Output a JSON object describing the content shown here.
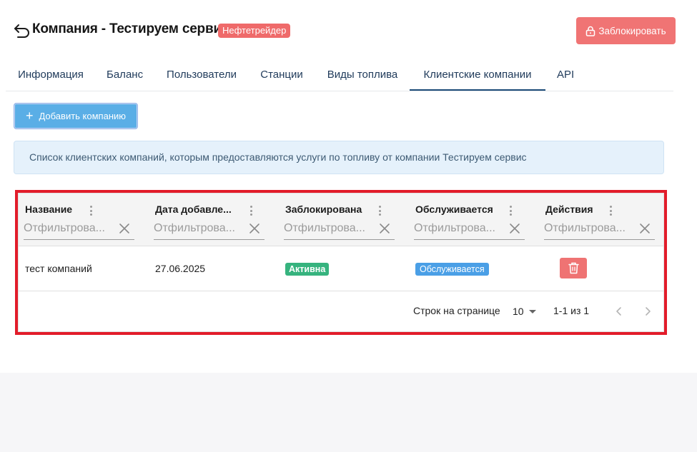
{
  "header": {
    "title": "Компания - Тестируем сервис",
    "role_badge": "Нефтетрейдер",
    "block_button": "Заблокировать"
  },
  "tabs": [
    {
      "label": "Информация",
      "active": false
    },
    {
      "label": "Баланс",
      "active": false
    },
    {
      "label": "Пользователи",
      "active": false
    },
    {
      "label": "Станции",
      "active": false
    },
    {
      "label": "Виды топлива",
      "active": false
    },
    {
      "label": "Клиентские компании",
      "active": true
    },
    {
      "label": "API",
      "active": false
    }
  ],
  "add_button": "Добавить компанию",
  "info_text": "Список клиентских компаний, которым предоставляются услуги по топливу от компании Тестируем сервис",
  "table": {
    "columns": [
      {
        "label": "Название",
        "filter_placeholder": "Отфильтрова..."
      },
      {
        "label": "Дата добавле...",
        "filter_placeholder": "Отфильтрова..."
      },
      {
        "label": "Заблокирована",
        "filter_placeholder": "Отфильтрова..."
      },
      {
        "label": "Обслуживается",
        "filter_placeholder": "Отфильтрова..."
      },
      {
        "label": "Действия",
        "filter_placeholder": "Отфильтрова..."
      }
    ],
    "rows": [
      {
        "name": "тест компаний",
        "date": "27.06.2025",
        "blocked": "Активна",
        "served": "Обслуживается"
      }
    ],
    "pagination": {
      "rows_per_page_label": "Строк на странице",
      "rows_per_page": "10",
      "range": "1-1 из 1"
    }
  },
  "colors": {
    "danger": "#f07474",
    "primary": "#5aaee6",
    "success": "#36b37e",
    "info": "#4a9fe6",
    "highlight_frame": "#e21c2a"
  }
}
